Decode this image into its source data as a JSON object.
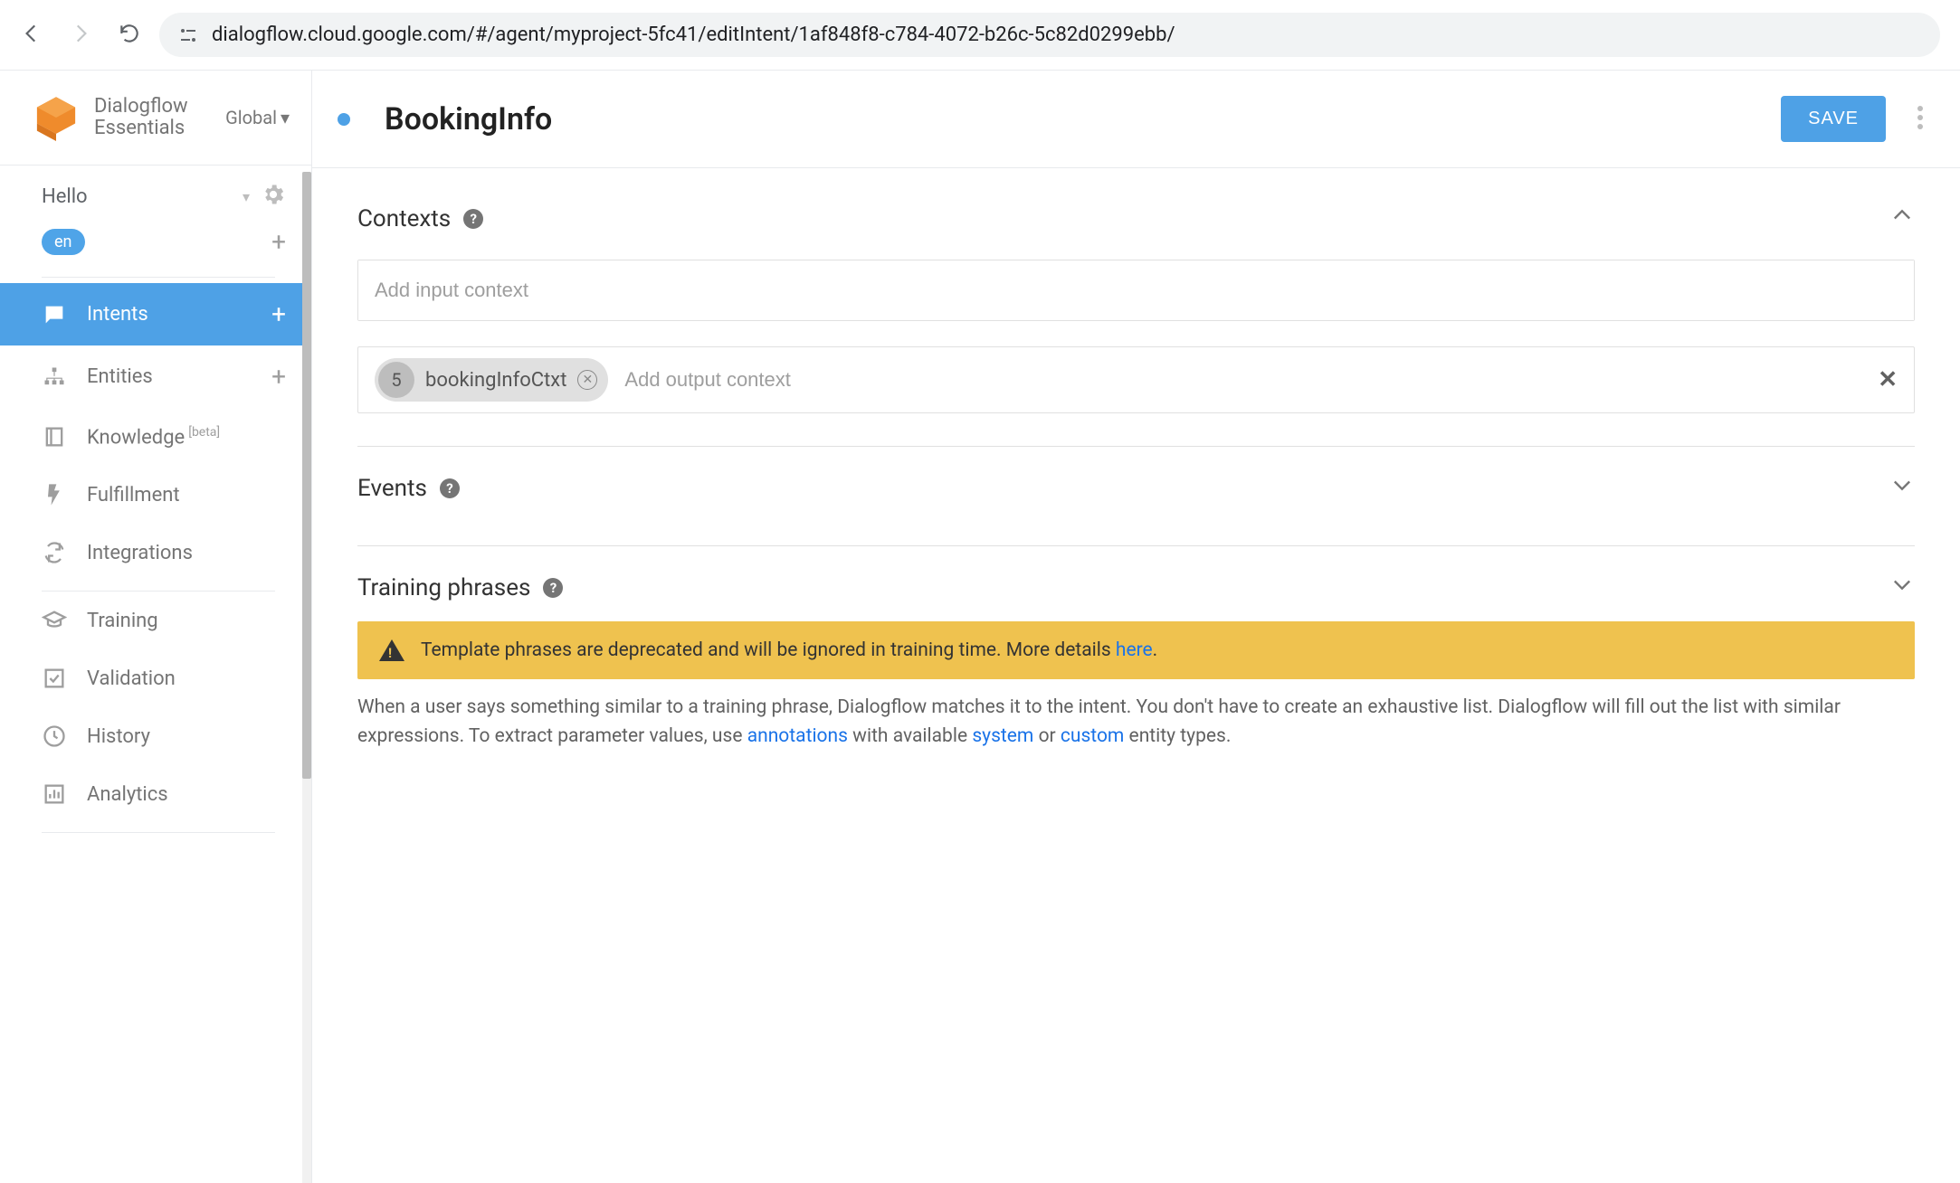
{
  "browser": {
    "url": "dialogflow.cloud.google.com/#/agent/myproject-5fc41/editIntent/1af848f8-c784-4072-b26c-5c82d0299ebb/"
  },
  "brand": {
    "line1": "Dialogflow",
    "line2": "Essentials",
    "region": "Global"
  },
  "agent": {
    "name": "Hello",
    "lang": "en"
  },
  "nav": {
    "intents": "Intents",
    "entities": "Entities",
    "knowledge": "Knowledge",
    "knowledge_badge": "[beta]",
    "fulfillment": "Fulfillment",
    "integrations": "Integrations",
    "training": "Training",
    "validation": "Validation",
    "history": "History",
    "analytics": "Analytics"
  },
  "intent": {
    "title": "BookingInfo",
    "save_label": "SAVE"
  },
  "sections": {
    "contexts": {
      "title": "Contexts",
      "input_placeholder": "Add input context",
      "output_placeholder": "Add output context",
      "chip_count": "5",
      "chip_label": "bookingInfoCtxt"
    },
    "events": {
      "title": "Events"
    },
    "training": {
      "title": "Training phrases",
      "warning_prefix": "Template phrases are deprecated and will be ignored in training time. More details ",
      "warning_link": "here",
      "help_1": "When a user says something similar to a training phrase, Dialogflow matches it to the intent. You don't have to create an exhaustive list. Dialogflow will fill out the list with similar expressions. To extract parameter values, use ",
      "link_annotations": "annotations",
      "help_2": " with available ",
      "link_system": "system",
      "help_3": " or ",
      "link_custom": "custom",
      "help_4": " entity types."
    }
  }
}
